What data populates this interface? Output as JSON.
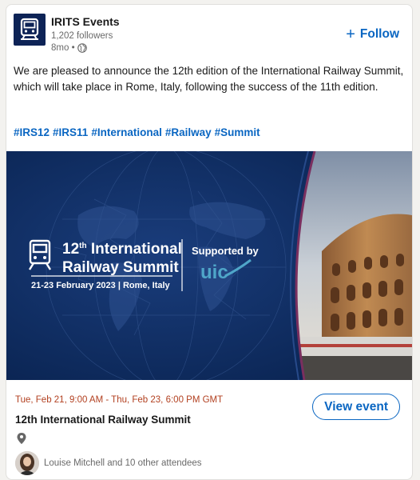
{
  "post": {
    "author": {
      "name": "IRITS Events",
      "followers": "1,202 followers",
      "time": "8mo •",
      "visibility_icon": "globe-icon"
    },
    "follow_label": "Follow",
    "text": "We are pleased to announce the 12th edition of the International Railway Summit, which will take place in Rome, Italy, following the success of the 11th edition.",
    "hashtags": [
      "#IRS12",
      "#IRS11",
      "#International",
      "#Railway",
      "#Summit"
    ]
  },
  "banner": {
    "ordinal_num": "12",
    "ordinal_suffix": "th",
    "title_line1": "International",
    "title_line2": "Railway Summit",
    "dates": "21-23 February 2023 | Rome, Italy",
    "supported_by": "Supported by",
    "sponsor": "uic"
  },
  "event": {
    "date_range": "Tue, Feb 21, 9:00 AM - Thu, Feb 23, 6:00 PM GMT",
    "title": "12th International Railway Summit",
    "attendees": "Louise Mitchell and 10 other attendees",
    "view_label": "View event"
  },
  "colors": {
    "brand_blue": "#0a66c2",
    "banner_navy": "#0b2a5b",
    "date_red": "#b24020"
  }
}
